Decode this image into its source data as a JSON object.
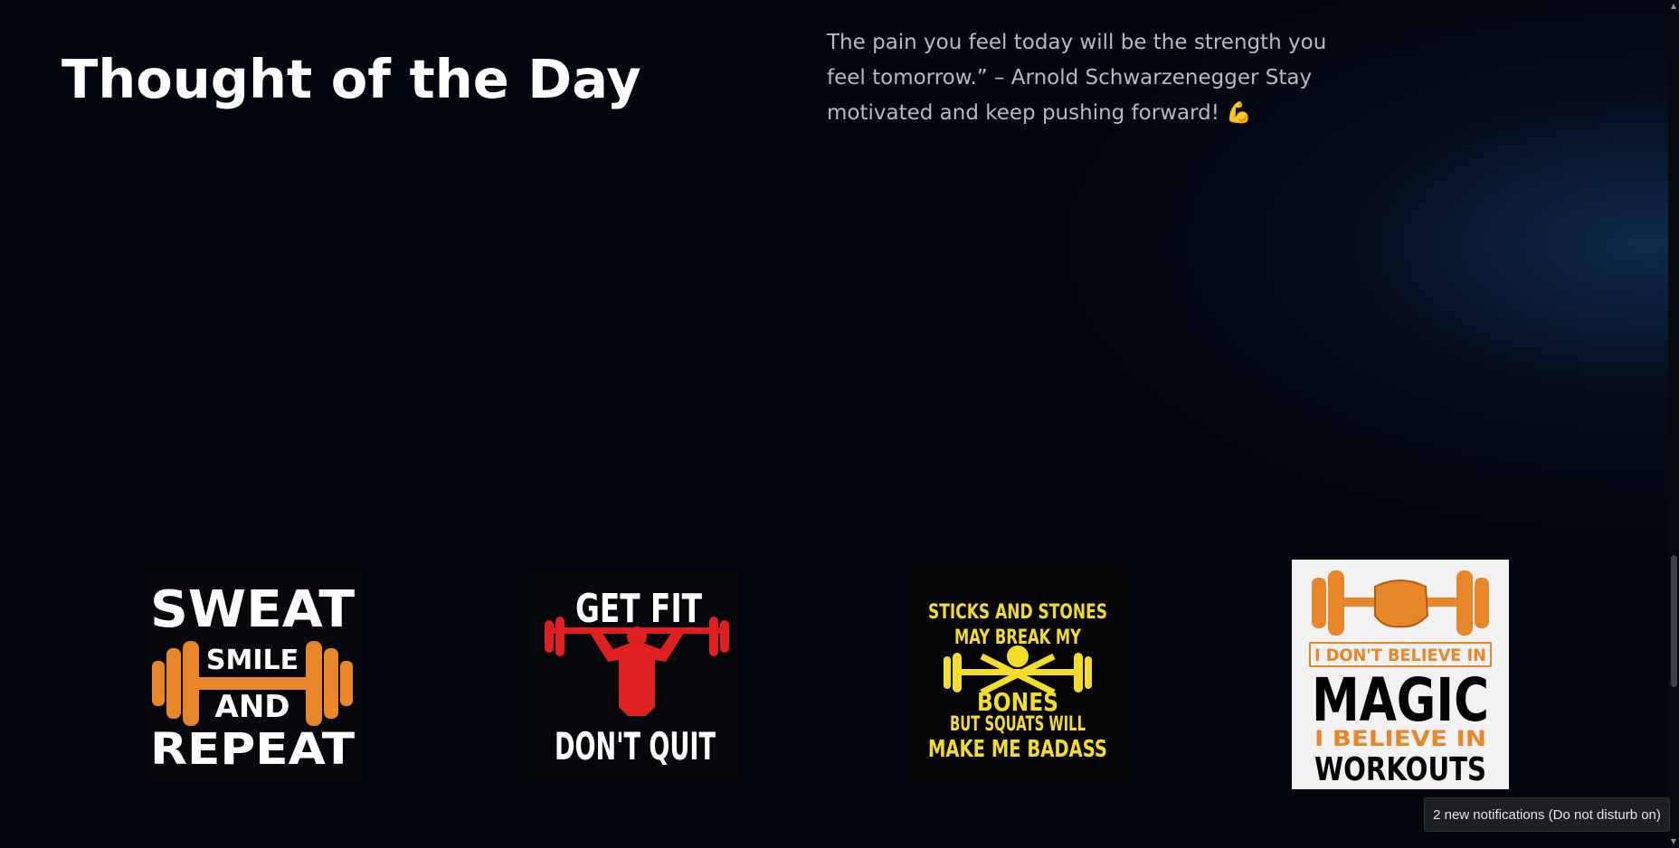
{
  "section": {
    "title": "Thought of the Day",
    "quote": "The pain you feel today will be the strength you feel tomorrow.” – Arnold Schwarzenegger Stay motivated and keep pushing forward!",
    "quote_emoji": "💪"
  },
  "gallery": [
    {
      "lines": [
        "SWEAT",
        "SMILE",
        "AND",
        "REPEAT"
      ]
    },
    {
      "lines": [
        "GET FIT",
        "DON'T QUIT"
      ]
    },
    {
      "lines": [
        "STICKS AND STONES",
        "MAY BREAK MY",
        "BONES",
        "BUT SQUATS WILL",
        "MAKE ME BADASS"
      ]
    },
    {
      "lines": [
        "I DON'T BELIEVE IN",
        "MAGIC",
        "I BELIEVE IN",
        "WORKOUTS"
      ]
    }
  ],
  "notification": {
    "text": "2 new notifications (Do not disturb on)"
  },
  "colors": {
    "background": "#02050d",
    "orange": "#e8862a",
    "red": "#e0201e",
    "yellow": "#f3dd2a"
  },
  "icons": {
    "scroll_up": "scroll-up-arrow-icon",
    "scroll_down": "scroll-down-arrow-icon"
  }
}
